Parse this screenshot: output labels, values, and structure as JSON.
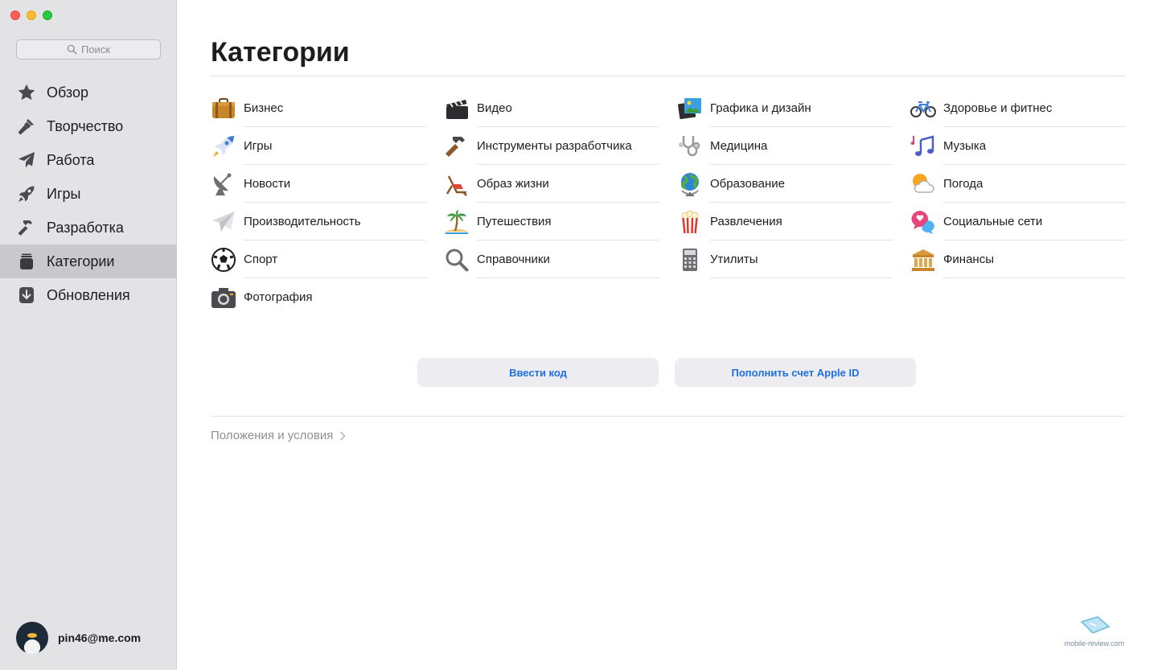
{
  "sidebar": {
    "search_placeholder": "Поиск",
    "items": [
      {
        "label": "Обзор",
        "icon": "star-icon"
      },
      {
        "label": "Творчество",
        "icon": "paintbrush-icon"
      },
      {
        "label": "Работа",
        "icon": "paperplane-icon"
      },
      {
        "label": "Игры",
        "icon": "rocket-icon"
      },
      {
        "label": "Разработка",
        "icon": "hammer-icon"
      },
      {
        "label": "Категории",
        "icon": "categories-icon",
        "active": true
      },
      {
        "label": "Обновления",
        "icon": "download-icon"
      }
    ],
    "account": {
      "email": "pin46@me.com"
    }
  },
  "main": {
    "title": "Категории",
    "categories": [
      {
        "label": "Бизнес",
        "icon": "briefcase-icon"
      },
      {
        "label": "Видео",
        "icon": "clapperboard-icon"
      },
      {
        "label": "Графика и дизайн",
        "icon": "picture-icon"
      },
      {
        "label": "Здоровье и фитнес",
        "icon": "bicycle-icon"
      },
      {
        "label": "Игры",
        "icon": "rocket-icon"
      },
      {
        "label": "Инструменты разработчика",
        "icon": "hammer-icon"
      },
      {
        "label": "Медицина",
        "icon": "stethoscope-icon"
      },
      {
        "label": "Музыка",
        "icon": "music-notes-icon"
      },
      {
        "label": "Новости",
        "icon": "satellite-dish-icon"
      },
      {
        "label": "Образ жизни",
        "icon": "beach-chair-icon"
      },
      {
        "label": "Образование",
        "icon": "globe-icon"
      },
      {
        "label": "Погода",
        "icon": "sun-cloud-icon"
      },
      {
        "label": "Производительность",
        "icon": "paperplane-icon"
      },
      {
        "label": "Путешествия",
        "icon": "palm-tree-icon"
      },
      {
        "label": "Развлечения",
        "icon": "popcorn-icon"
      },
      {
        "label": "Социальные сети",
        "icon": "heart-bubble-icon"
      },
      {
        "label": "Спорт",
        "icon": "soccer-ball-icon"
      },
      {
        "label": "Справочники",
        "icon": "magnifier-icon"
      },
      {
        "label": "Утилиты",
        "icon": "calculator-icon"
      },
      {
        "label": "Финансы",
        "icon": "bank-icon"
      },
      {
        "label": "Фотография",
        "icon": "camera-icon"
      }
    ],
    "buttons": {
      "redeem_code": "Ввести код",
      "add_funds": "Пополнить счет Apple ID"
    },
    "terms_link": "Положения и условия",
    "watermark": "mobile-review.com"
  }
}
